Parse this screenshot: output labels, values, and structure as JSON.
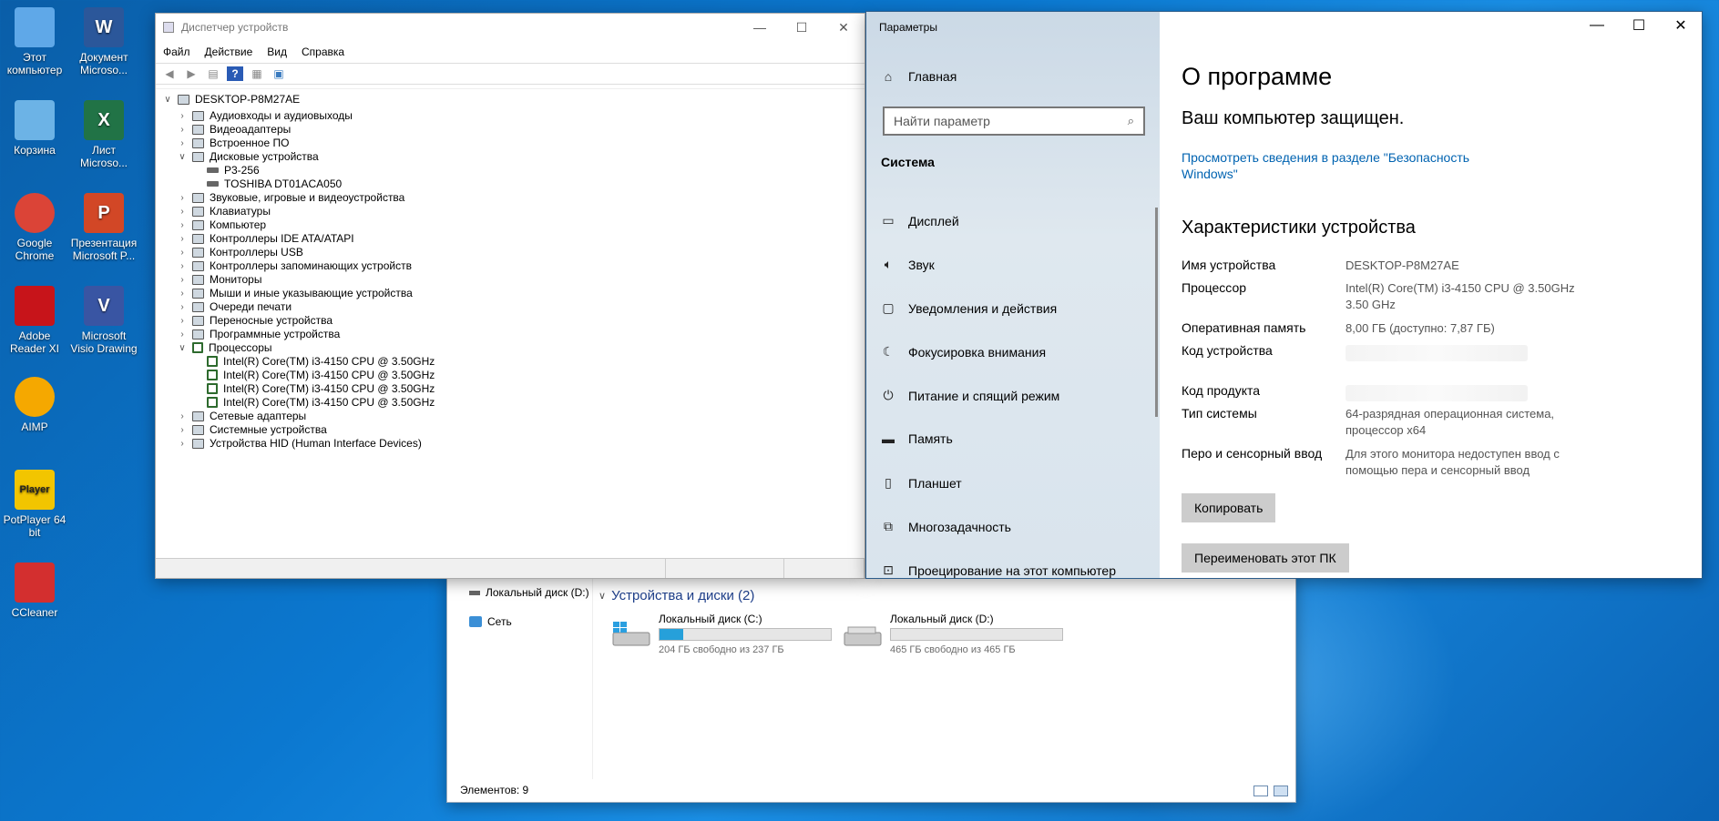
{
  "desktop": {
    "icons": [
      {
        "label": "Этот компьютер",
        "icon": "this-pc-icon",
        "color": "#5fa8e8"
      },
      {
        "label": "Документ Microso...",
        "icon": "word-doc-icon",
        "color": "#2b579a",
        "glyph": "W"
      },
      {
        "label": "Корзина",
        "icon": "recycle-bin-icon",
        "color": "#6cb3e6"
      },
      {
        "label": "Лист Microso...",
        "icon": "excel-sheet-icon",
        "color": "#217346",
        "glyph": "X"
      },
      {
        "label": "Google Chrome",
        "icon": "chrome-icon",
        "color": "#db4437"
      },
      {
        "label": "Презентация Microsoft P...",
        "icon": "powerpoint-icon",
        "color": "#d24726",
        "glyph": "P"
      },
      {
        "label": "Adobe Reader XI",
        "icon": "adobe-reader-icon",
        "color": "#c7141a"
      },
      {
        "label": "Microsoft Visio Drawing",
        "icon": "visio-icon",
        "color": "#3955a3",
        "glyph": "V"
      },
      {
        "label": "AIMP",
        "icon": "aimp-icon",
        "color": "#f5a800"
      },
      {
        "label": "PotPlayer 64 bit",
        "icon": "potplayer-icon",
        "color": "#f2c500",
        "glyph": "Player"
      },
      {
        "label": "CCleaner",
        "icon": "ccleaner-icon",
        "color": "#d32f2f"
      }
    ]
  },
  "explorer": {
    "nav": {
      "local_disk_d": "Локальный диск (D:)",
      "network": "Сеть"
    },
    "group_title": "Устройства и диски (2)",
    "drives": [
      {
        "name": "Локальный диск (C:)",
        "free": "204 ГБ свободно из 237 ГБ",
        "used_fraction": 0.14
      },
      {
        "name": "Локальный диск (D:)",
        "free": "465 ГБ свободно из 465 ГБ",
        "used_fraction": 0.0
      }
    ],
    "status": "Элементов: 9"
  },
  "devmgr": {
    "title": "Диспетчер устройств",
    "menu": [
      "Файл",
      "Действие",
      "Вид",
      "Справка"
    ],
    "root": "DESKTOP-P8M27AE",
    "tree": [
      {
        "label": "Аудиовходы и аудиовыходы",
        "state": "collapsed",
        "level": 1
      },
      {
        "label": "Видеоадаптеры",
        "state": "collapsed",
        "level": 1
      },
      {
        "label": "Встроенное ПО",
        "state": "collapsed",
        "level": 1
      },
      {
        "label": "Дисковые устройства",
        "state": "expanded",
        "level": 1
      },
      {
        "label": "P3-256",
        "state": "leaf",
        "level": 2,
        "kind": "disk"
      },
      {
        "label": "TOSHIBA DT01ACA050",
        "state": "leaf",
        "level": 2,
        "kind": "disk"
      },
      {
        "label": "Звуковые, игровые и видеоустройства",
        "state": "collapsed",
        "level": 1
      },
      {
        "label": "Клавиатуры",
        "state": "collapsed",
        "level": 1
      },
      {
        "label": "Компьютер",
        "state": "collapsed",
        "level": 1
      },
      {
        "label": "Контроллеры IDE ATA/ATAPI",
        "state": "collapsed",
        "level": 1
      },
      {
        "label": "Контроллеры USB",
        "state": "collapsed",
        "level": 1
      },
      {
        "label": "Контроллеры запоминающих устройств",
        "state": "collapsed",
        "level": 1
      },
      {
        "label": "Мониторы",
        "state": "collapsed",
        "level": 1
      },
      {
        "label": "Мыши и иные указывающие устройства",
        "state": "collapsed",
        "level": 1
      },
      {
        "label": "Очереди печати",
        "state": "collapsed",
        "level": 1
      },
      {
        "label": "Переносные устройства",
        "state": "collapsed",
        "level": 1
      },
      {
        "label": "Программные устройства",
        "state": "collapsed",
        "level": 1
      },
      {
        "label": "Процессоры",
        "state": "expanded",
        "level": 1,
        "kind": "cpu"
      },
      {
        "label": "Intel(R) Core(TM) i3-4150 CPU @ 3.50GHz",
        "state": "leaf",
        "level": 2,
        "kind": "cpu"
      },
      {
        "label": "Intel(R) Core(TM) i3-4150 CPU @ 3.50GHz",
        "state": "leaf",
        "level": 2,
        "kind": "cpu"
      },
      {
        "label": "Intel(R) Core(TM) i3-4150 CPU @ 3.50GHz",
        "state": "leaf",
        "level": 2,
        "kind": "cpu"
      },
      {
        "label": "Intel(R) Core(TM) i3-4150 CPU @ 3.50GHz",
        "state": "leaf",
        "level": 2,
        "kind": "cpu"
      },
      {
        "label": "Сетевые адаптеры",
        "state": "collapsed",
        "level": 1
      },
      {
        "label": "Системные устройства",
        "state": "collapsed",
        "level": 1
      },
      {
        "label": "Устройства HID (Human Interface Devices)",
        "state": "collapsed",
        "level": 1
      }
    ]
  },
  "settings": {
    "title": "Параметры",
    "home": "Главная",
    "search_placeholder": "Найти параметр",
    "section": "Система",
    "nav": [
      {
        "label": "Дисплей",
        "icon": "display-icon",
        "glyph": "▭"
      },
      {
        "label": "Звук",
        "icon": "sound-icon",
        "glyph": "🔈︎"
      },
      {
        "label": "Уведомления и действия",
        "icon": "notifications-icon",
        "glyph": "▢"
      },
      {
        "label": "Фокусировка внимания",
        "icon": "focus-assist-icon",
        "glyph": "☾"
      },
      {
        "label": "Питание и спящий режим",
        "icon": "power-icon",
        "glyph": "⏻"
      },
      {
        "label": "Память",
        "icon": "storage-icon",
        "glyph": "▬"
      },
      {
        "label": "Планшет",
        "icon": "tablet-icon",
        "glyph": "▯"
      },
      {
        "label": "Многозадачность",
        "icon": "multitasking-icon",
        "glyph": "⧉"
      },
      {
        "label": "Проецирование на этот компьютер",
        "icon": "projecting-icon",
        "glyph": "⊡"
      }
    ],
    "page_title": "О программе",
    "protected": "Ваш компьютер защищен.",
    "security_link": "Просмотреть сведения в разделе \"Безопасность Windows\"",
    "specs_title": "Характеристики устройства",
    "specs": [
      {
        "label": "Имя устройства",
        "value": "DESKTOP-P8M27AE"
      },
      {
        "label": "Процессор",
        "value": "Intel(R) Core(TM) i3-4150 CPU @ 3.50GHz 3.50 GHz"
      },
      {
        "label": "Оперативная память",
        "value": "8,00 ГБ (доступно: 7,87 ГБ)"
      },
      {
        "label": "Код устройства",
        "value": ""
      },
      {
        "label": "Код продукта",
        "value": ""
      },
      {
        "label": "Тип системы",
        "value": "64-разрядная операционная система, процессор x64"
      },
      {
        "label": "Перо и сенсорный ввод",
        "value": "Для этого монитора недоступен ввод с помощью пера и сенсорный ввод"
      }
    ],
    "copy_button": "Копировать",
    "rename_button": "Переименовать этот ПК"
  }
}
